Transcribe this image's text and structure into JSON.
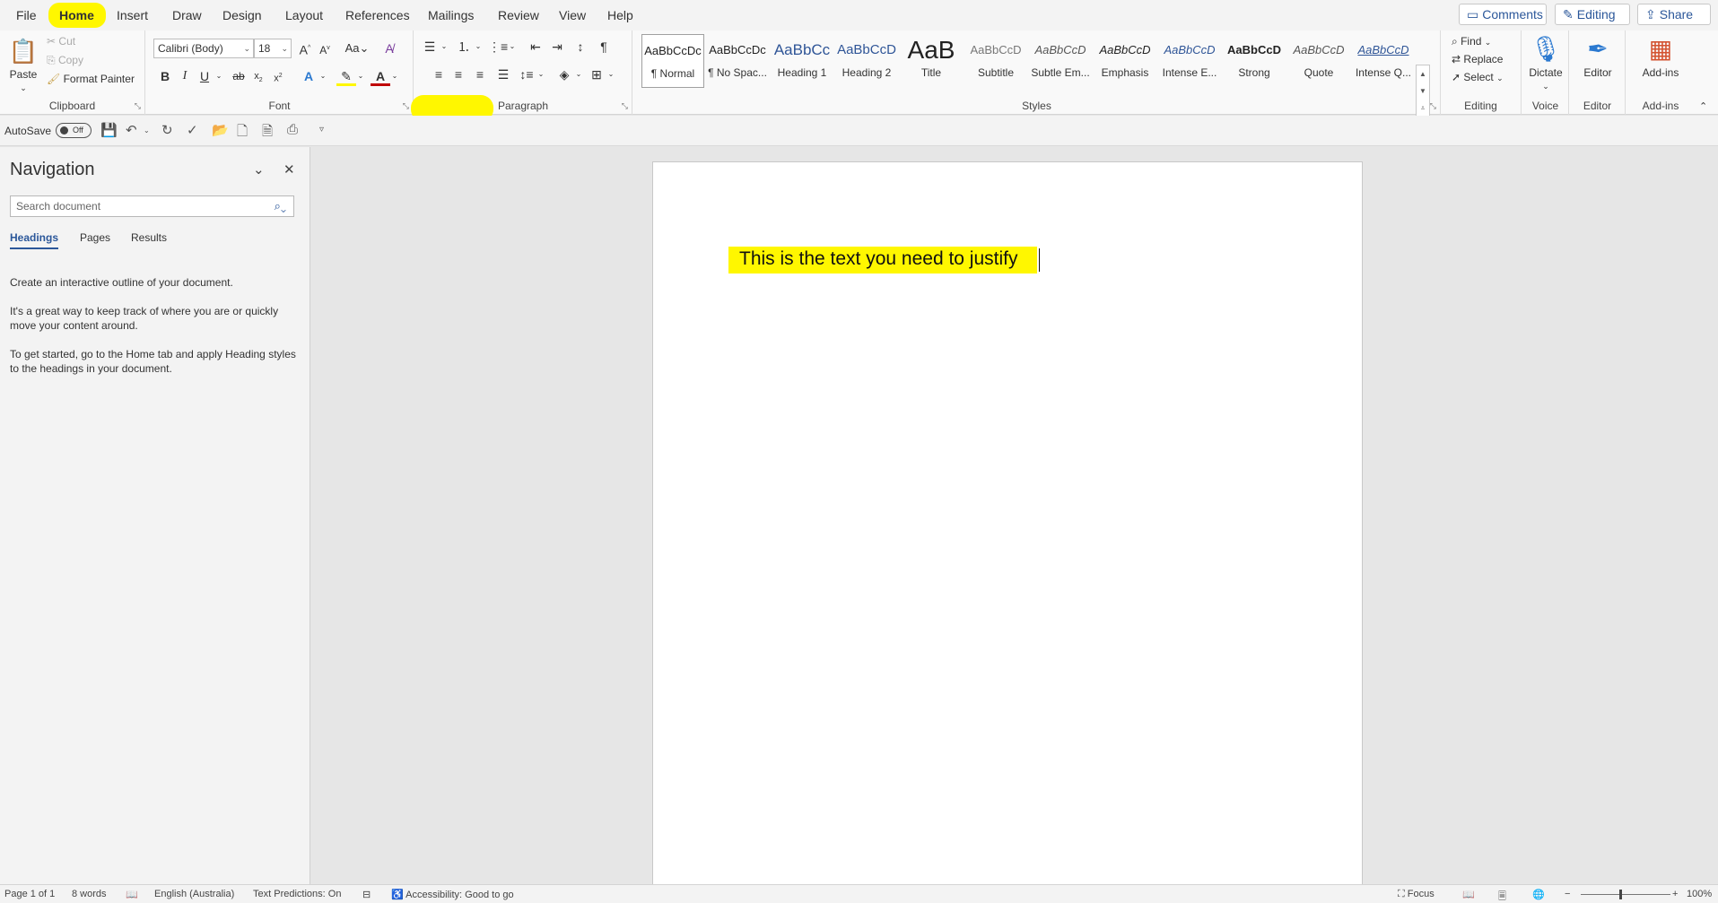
{
  "tabs": [
    "File",
    "Home",
    "Insert",
    "Draw",
    "Design",
    "Layout",
    "References",
    "Mailings",
    "Review",
    "View",
    "Help"
  ],
  "active_tab": "Home",
  "top_right": {
    "comments": "Comments",
    "editing": "Editing",
    "share": "Share"
  },
  "clipboard": {
    "paste": "Paste",
    "cut": "Cut",
    "copy": "Copy",
    "format_painter": "Format Painter",
    "label": "Clipboard"
  },
  "font": {
    "name": "Calibri (Body)",
    "size": "18",
    "label": "Font"
  },
  "paragraph": {
    "label": "Paragraph"
  },
  "styles": {
    "label": "Styles",
    "items": [
      {
        "preview": "AaBbCcDc",
        "name": "¶ Normal"
      },
      {
        "preview": "AaBbCcDc",
        "name": "¶ No Spac..."
      },
      {
        "preview": "AaBbCc",
        "name": "Heading 1"
      },
      {
        "preview": "AaBbCcD",
        "name": "Heading 2"
      },
      {
        "preview": "AaB",
        "name": "Title"
      },
      {
        "preview": "AaBbCcD",
        "name": "Subtitle"
      },
      {
        "preview": "AaBbCcD",
        "name": "Subtle Em..."
      },
      {
        "preview": "AaBbCcD",
        "name": "Emphasis"
      },
      {
        "preview": "AaBbCcD",
        "name": "Intense E..."
      },
      {
        "preview": "AaBbCcD",
        "name": "Strong"
      },
      {
        "preview": "AaBbCcD",
        "name": "Quote"
      },
      {
        "preview": "AaBbCcD",
        "name": "Intense Q..."
      }
    ]
  },
  "editing": {
    "find": "Find",
    "replace": "Replace",
    "select": "Select",
    "label": "Editing"
  },
  "voice": {
    "dictate": "Dictate",
    "label": "Voice"
  },
  "editor": {
    "button": "Editor",
    "label": "Editor"
  },
  "addins": {
    "button": "Add-ins",
    "label": "Add-ins"
  },
  "qat": {
    "autosave": "AutoSave",
    "toggle": "Off"
  },
  "navigation": {
    "title": "Navigation",
    "search_placeholder": "Search document",
    "tabs": [
      "Headings",
      "Pages",
      "Results"
    ],
    "p1": "Create an interactive outline of your document.",
    "p2": "It's a great way to keep track of where you are or quickly move your content around.",
    "p3": "To get started, go to the Home tab and apply Heading styles to the headings in your document."
  },
  "document": {
    "text": "This is the text you need to justify"
  },
  "status": {
    "page": "Page 1 of 1",
    "words": "8 words",
    "language": "English (Australia)",
    "predictions": "Text Predictions: On",
    "accessibility": "Accessibility: Good to go",
    "focus": "Focus",
    "zoom": "100%"
  },
  "colors": {
    "highlight": "#fff700",
    "accent": "#2b579a",
    "font_color": "#c00000"
  }
}
